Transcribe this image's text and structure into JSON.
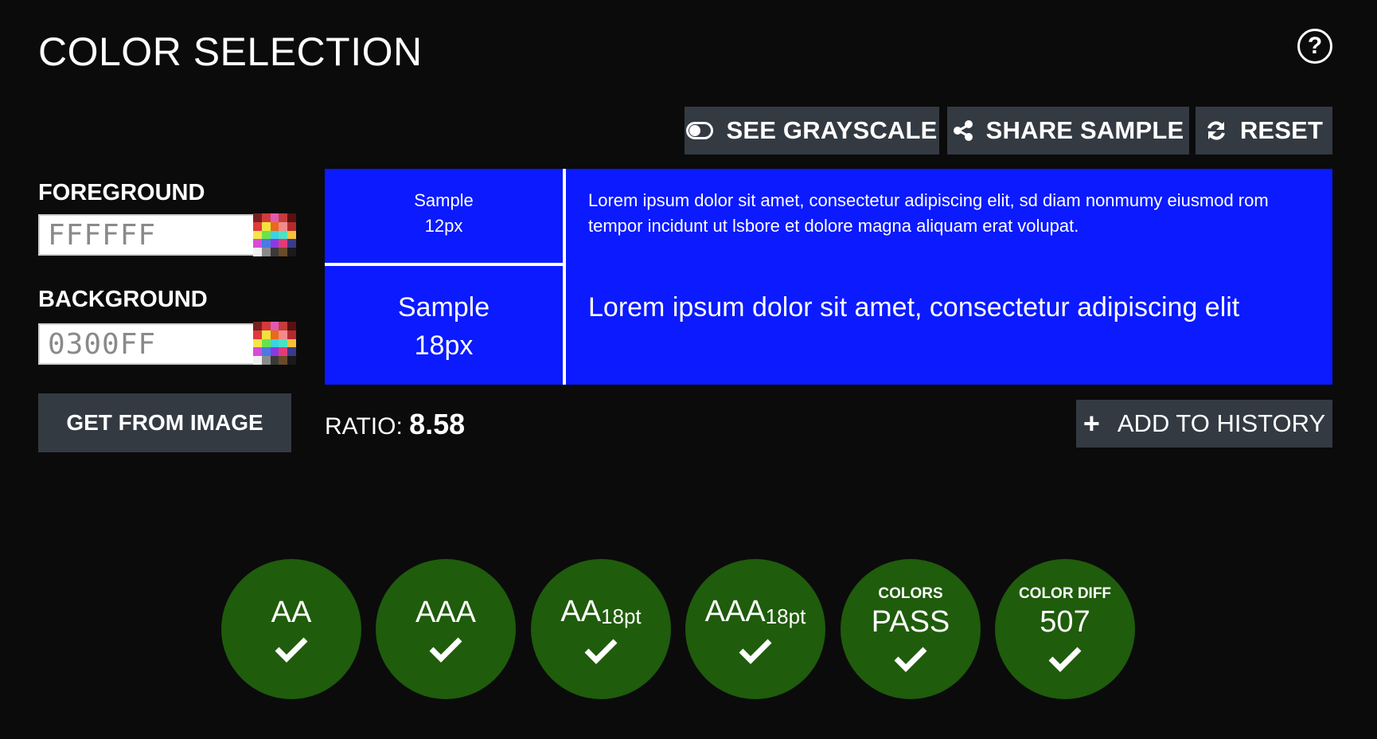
{
  "header": {
    "title": "COLOR SELECTION",
    "help_label": "?"
  },
  "toolbar": {
    "grayscale_label": "SEE GRAYSCALE",
    "share_label": "SHARE SAMPLE",
    "reset_label": "RESET"
  },
  "inputs": {
    "foreground_label": "FOREGROUND",
    "foreground_value": "FFFFFF",
    "background_label": "BACKGROUND",
    "background_value": "0300FF",
    "get_from_image_label": "GET FROM IMAGE"
  },
  "sample": {
    "small_label_line1": "Sample",
    "small_label_line2": "12px",
    "small_text": "Lorem ipsum dolor sit amet, consectetur adipiscing elit, sd diam nonmumy eiusmod rom tempor incidunt ut lsbore et dolore magna aliquam erat volupat.",
    "large_label_line1": "Sample",
    "large_label_line2": "18px",
    "large_text": "Lorem ipsum dolor sit amet, consectetur adipiscing elit",
    "background_color": "#0b1aff",
    "foreground_color": "#ffffff"
  },
  "ratio": {
    "label": "RATIO:",
    "value": "8.58"
  },
  "history": {
    "add_label": "ADD TO HISTORY"
  },
  "results": [
    {
      "small": "",
      "main": "AA",
      "sub": "",
      "status": "pass"
    },
    {
      "small": "",
      "main": "AAA",
      "sub": "",
      "status": "pass"
    },
    {
      "small": "",
      "main": "AA",
      "sub": "18pt",
      "status": "pass"
    },
    {
      "small": "",
      "main": "AAA",
      "sub": "18pt",
      "status": "pass"
    },
    {
      "small": "COLORS",
      "main": "PASS",
      "sub": "",
      "status": "pass"
    },
    {
      "small": "COLOR DIFF",
      "main": "507",
      "sub": "",
      "status": "pass"
    }
  ],
  "colors": {
    "page_bg": "#0b0b0b",
    "button_bg": "#343a42",
    "pass_green": "#1f5c0c"
  },
  "icons": {
    "toggle": "toggle-icon",
    "share": "share-icon",
    "reset": "refresh-icon",
    "help": "help-icon",
    "add": "plus-icon",
    "check": "check-icon",
    "palette": "palette-icon"
  }
}
